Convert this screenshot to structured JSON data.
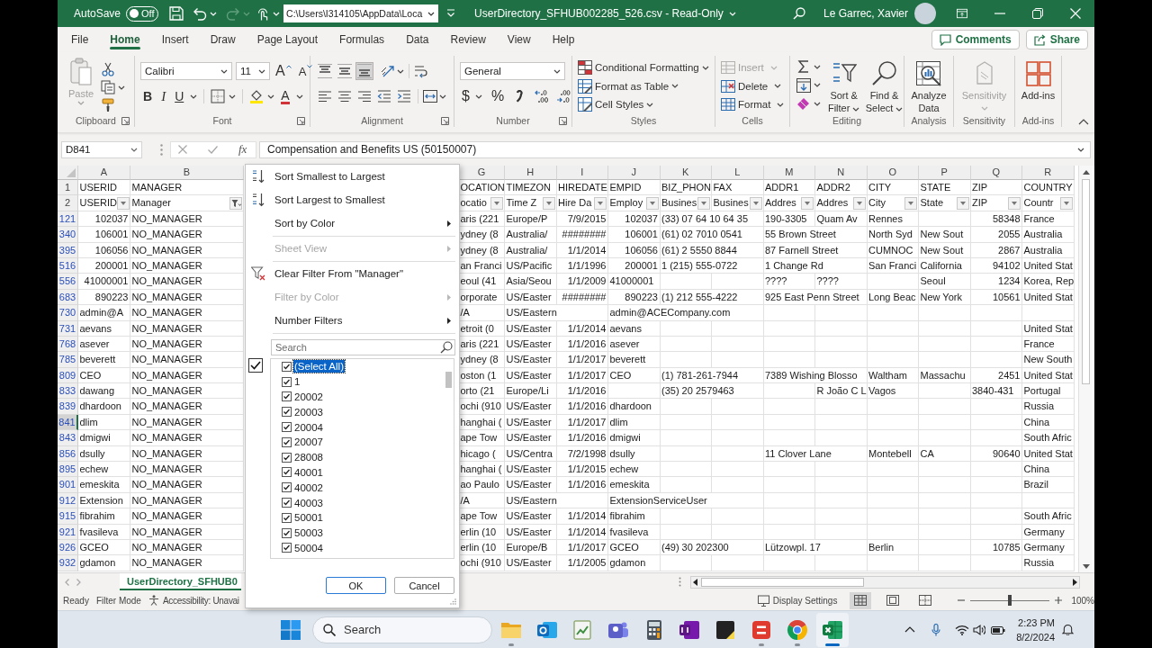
{
  "title_bar": {
    "autosave_label": "AutoSave",
    "autosave_on": false,
    "autosave_state": "Off",
    "redo_disabled": true,
    "file_path": "C:\\Users\\I314105\\AppData\\Loca",
    "document_title": "UserDirectory_SFHUB002285_526.csv - Read-Only",
    "user_name": "Le Garrec, Xavier"
  },
  "menu_tabs": [
    {
      "label": "File",
      "selected": false
    },
    {
      "label": "Home",
      "selected": true
    },
    {
      "label": "Insert",
      "selected": false
    },
    {
      "label": "Draw",
      "selected": false
    },
    {
      "label": "Page Layout",
      "selected": false
    },
    {
      "label": "Formulas",
      "selected": false
    },
    {
      "label": "Data",
      "selected": false
    },
    {
      "label": "Review",
      "selected": false
    },
    {
      "label": "View",
      "selected": false
    },
    {
      "label": "Help",
      "selected": false
    }
  ],
  "header_buttons": [
    {
      "kind": "comments",
      "label": "Comments"
    },
    {
      "kind": "share",
      "label": "Share"
    }
  ],
  "ribbon": {
    "clipboard": {
      "paste": {
        "label": "Paste",
        "disabled": true
      },
      "label": "Clipboard"
    },
    "font": {
      "font_name": "Calibri",
      "font_size": "11",
      "grow": "A",
      "shrink": "A",
      "bold": "B",
      "italic": "I",
      "underline": "U",
      "font_color": "A",
      "label": "Font"
    },
    "alignment": {
      "vertical": [
        {
          "kind": "top",
          "selected": false
        },
        {
          "kind": "middle",
          "selected": false
        },
        {
          "kind": "bottom",
          "selected": true
        }
      ],
      "label": "Alignment"
    },
    "number": {
      "format": "General",
      "currency": "$",
      "percent": "%",
      "label": "Number"
    },
    "styles": {
      "items": [
        {
          "kind": "conditional",
          "label": "Conditional Formatting"
        },
        {
          "kind": "table",
          "label": "Format as Table"
        },
        {
          "kind": "cell_styles",
          "label": "Cell Styles"
        }
      ],
      "label": "Styles"
    },
    "cells": {
      "items": [
        {
          "kind": "insert",
          "label": "Insert",
          "disabled": true
        },
        {
          "kind": "delete",
          "label": "Delete",
          "disabled": false
        },
        {
          "kind": "format",
          "label": "Format",
          "disabled": false
        }
      ],
      "label": "Cells"
    },
    "editing": {
      "sort_filter": "Sort & Filter",
      "find_select": "Find & Select",
      "label": "Editing"
    },
    "analysis": {
      "analyze": "Analyze Data",
      "label": "Analysis"
    },
    "sensitivity": {
      "button": "Sensitivity",
      "disabled": true,
      "label": "Sensitivity"
    },
    "addins": {
      "button": "Add-ins",
      "label": "Add-ins"
    }
  },
  "formula_bar": {
    "name_box": "D841",
    "fx": "fx",
    "formula": "Compensation and Benefits US (50150007)"
  },
  "sheet": {
    "columns": [
      "A",
      "B",
      "G",
      "H",
      "I",
      "J",
      "K",
      "L",
      "M",
      "N",
      "O",
      "P",
      "Q",
      "R"
    ],
    "title_row": {
      "number": "1",
      "cells": {
        "A": "USERID",
        "B": "MANAGER",
        "G": "OCATION",
        "H": "TIMEZON",
        "I": "HIREDATE",
        "J": "EMPID",
        "K": "BIZ_PHON",
        "L": "FAX",
        "M": "ADDR1",
        "N": "ADDR2",
        "O": "CITY",
        "P": "STATE",
        "Q": "ZIP",
        "R": "COUNTRY"
      }
    },
    "header_row": {
      "number": "2",
      "cells": {
        "A": {
          "text": "USERID",
          "filtered": false
        },
        "B": {
          "text": "Manager",
          "filtered": true
        },
        "G": {
          "text": "ocatio",
          "filtered": false
        },
        "H": {
          "text": "Time Z",
          "filtered": false
        },
        "I": {
          "text": "Hire Da",
          "filtered": false
        },
        "J": {
          "text": "Employ",
          "filtered": false
        },
        "K": {
          "text": "Busines",
          "filtered": false
        },
        "L": {
          "text": "Busines",
          "filtered": false
        },
        "M": {
          "text": "Addres",
          "filtered": false
        },
        "N": {
          "text": "Addres",
          "filtered": false
        },
        "O": {
          "text": "City",
          "filtered": false
        },
        "P": {
          "text": "State",
          "filtered": false
        },
        "Q": {
          "text": "ZIP",
          "filtered": false
        },
        "R": {
          "text": "Countr",
          "filtered": false
        }
      }
    },
    "rows": [
      {
        "number": "121",
        "filtered": true,
        "selected": false,
        "cells": {
          "A": {
            "kind": "number",
            "text": "102037"
          },
          "B": "NO_MANAGER",
          "G": "aris (221",
          "H": "Europe/P",
          "I": {
            "kind": "number",
            "text": "7/9/2015"
          },
          "J": {
            "kind": "number",
            "text": "102037"
          },
          "K": "(33) 07 64 10 64 35",
          "M": "190-3305",
          "N": "Quam Av",
          "O": "Rennes",
          "Q": {
            "kind": "number",
            "text": "58348"
          },
          "R": "France"
        }
      },
      {
        "number": "340",
        "filtered": true,
        "selected": false,
        "cells": {
          "A": {
            "kind": "number",
            "text": "106001"
          },
          "B": "NO_MANAGER",
          "G": "ydney (8",
          "H": "Australia/",
          "I": {
            "kind": "number",
            "text": "########"
          },
          "J": {
            "kind": "number",
            "text": "106001"
          },
          "K": "(61) 02 7010 0541",
          "M": "55 Brown Street",
          "O": "North Syd",
          "P": "New Sout",
          "Q": {
            "kind": "number",
            "text": "2055"
          },
          "R": "Australia"
        }
      },
      {
        "number": "395",
        "filtered": true,
        "selected": false,
        "cells": {
          "A": {
            "kind": "number",
            "text": "106056"
          },
          "B": "NO_MANAGER",
          "G": "ydney (8",
          "H": "Australia/",
          "I": {
            "kind": "number",
            "text": "1/1/2014"
          },
          "J": {
            "kind": "number",
            "text": "106056"
          },
          "K": "(61) 2 5550 8844",
          "M": "87 Farnell Street",
          "O": "CUMNOC",
          "P": "New Sout",
          "Q": {
            "kind": "number",
            "text": "2867"
          },
          "R": "Australia"
        }
      },
      {
        "number": "516",
        "filtered": true,
        "selected": false,
        "cells": {
          "A": {
            "kind": "number",
            "text": "200001"
          },
          "B": "NO_MANAGER",
          "G": "an Franci",
          "H": "US/Pacific",
          "I": {
            "kind": "number",
            "text": "1/1/1996"
          },
          "J": {
            "kind": "number",
            "text": "200001"
          },
          "K": "1 (215) 555-0722",
          "M": "1 Change Rd",
          "O": "San Franci",
          "P": "California",
          "Q": {
            "kind": "number",
            "text": "94102"
          },
          "R": "United Stat"
        }
      },
      {
        "number": "556",
        "filtered": true,
        "selected": false,
        "cells": {
          "A": {
            "kind": "number",
            "text": "41000001"
          },
          "B": "NO_MANAGER",
          "G": "eoul (41",
          "H": "Asia/Seou",
          "I": {
            "kind": "number",
            "text": "1/1/2009"
          },
          "J": "41000001",
          "M": "????",
          "N": "????",
          "P": "Seoul",
          "Q": {
            "kind": "number",
            "text": "1234"
          },
          "R": "Korea, Rep"
        }
      },
      {
        "number": "683",
        "filtered": true,
        "selected": false,
        "cells": {
          "A": {
            "kind": "number",
            "text": "890223"
          },
          "B": "NO_MANAGER",
          "G": "orporate",
          "H": "US/Easter",
          "I": {
            "kind": "number",
            "text": "########"
          },
          "J": {
            "kind": "number",
            "text": "890223"
          },
          "K": "(1) 212 555-4222",
          "M": "925 East Penn Street",
          "O": "Long Beac",
          "P": "New York",
          "Q": {
            "kind": "number",
            "text": "10561"
          },
          "R": "United Stat"
        }
      },
      {
        "number": "730",
        "filtered": true,
        "selected": false,
        "cells": {
          "A": "admin@A",
          "B": "NO_MANAGER",
          "G": "/A",
          "H": "US/Eastern",
          "J": "admin@ACECompany.com"
        }
      },
      {
        "number": "731",
        "filtered": true,
        "selected": false,
        "cells": {
          "A": "aevans",
          "B": "NO_MANAGER",
          "G": "etroit (0",
          "H": "US/Easter",
          "I": {
            "kind": "number",
            "text": "1/1/2014"
          },
          "J": "aevans",
          "R": "United Stat"
        }
      },
      {
        "number": "768",
        "filtered": true,
        "selected": false,
        "cells": {
          "A": "asever",
          "B": "NO_MANAGER",
          "G": "aris (221",
          "H": "US/Easter",
          "I": {
            "kind": "number",
            "text": "1/1/2016"
          },
          "J": "asever",
          "R": "France"
        }
      },
      {
        "number": "785",
        "filtered": true,
        "selected": false,
        "cells": {
          "A": "beverett",
          "B": "NO_MANAGER",
          "G": "ydney (8",
          "H": "US/Easter",
          "I": {
            "kind": "number",
            "text": "1/1/2017"
          },
          "J": "beverett",
          "R": "New South"
        }
      },
      {
        "number": "809",
        "filtered": true,
        "selected": false,
        "cells": {
          "A": "CEO",
          "B": "NO_MANAGER",
          "G": "oston (1",
          "H": "US/Easter",
          "I": {
            "kind": "number",
            "text": "1/1/2017"
          },
          "J": "CEO",
          "K": "(1) 781-261-7944",
          "M": "7389 Wishing Blosso",
          "O": "Waltham",
          "P": "Massachu",
          "Q": {
            "kind": "number",
            "text": "2451"
          },
          "R": "United Stat"
        }
      },
      {
        "number": "833",
        "filtered": true,
        "selected": false,
        "cells": {
          "A": "dawang",
          "B": "NO_MANAGER",
          "G": "orto (21",
          "H": "Europe/Li",
          "I": {
            "kind": "number",
            "text": "1/1/2016"
          },
          "K": "(35) 20 2579463",
          "N": "R João C L",
          "O": "Vagos",
          "Q": "3840-431",
          "R": "Portugal"
        }
      },
      {
        "number": "839",
        "filtered": true,
        "selected": false,
        "cells": {
          "A": "dhardoon",
          "B": "NO_MANAGER",
          "G": "ochi (910",
          "H": "US/Easter",
          "I": {
            "kind": "number",
            "text": "1/1/2016"
          },
          "J": "dhardoon",
          "R": "Russia"
        }
      },
      {
        "number": "841",
        "filtered": true,
        "selected": true,
        "cells": {
          "A": "dlim",
          "B": "NO_MANAGER",
          "G": "hanghai (",
          "H": "US/Easter",
          "I": {
            "kind": "number",
            "text": "1/1/2017"
          },
          "J": "dlim",
          "R": "China"
        }
      },
      {
        "number": "843",
        "filtered": true,
        "selected": false,
        "cells": {
          "A": "dmigwi",
          "B": "NO_MANAGER",
          "G": "ape Tow",
          "H": "US/Easter",
          "I": {
            "kind": "number",
            "text": "1/1/2016"
          },
          "J": "dmigwi",
          "R": "South Afric"
        }
      },
      {
        "number": "856",
        "filtered": true,
        "selected": false,
        "cells": {
          "A": "dsully",
          "B": "NO_MANAGER",
          "G": "hicago (",
          "H": "US/Centra",
          "I": {
            "kind": "number",
            "text": "7/2/1998"
          },
          "J": "dsully",
          "M": "11 Clover Lane",
          "O": "Montebell",
          "P": "CA",
          "Q": {
            "kind": "number",
            "text": "90640"
          },
          "R": "United Stat"
        }
      },
      {
        "number": "895",
        "filtered": true,
        "selected": false,
        "cells": {
          "A": "echew",
          "B": "NO_MANAGER",
          "G": "hanghai (",
          "H": "US/Easter",
          "I": {
            "kind": "number",
            "text": "1/1/2015"
          },
          "J": "echew",
          "R": "China"
        }
      },
      {
        "number": "901",
        "filtered": true,
        "selected": false,
        "cells": {
          "A": "emeskita",
          "B": "NO_MANAGER",
          "G": "ao Paulo",
          "H": "US/Easter",
          "I": {
            "kind": "number",
            "text": "1/1/2016"
          },
          "J": "emeskita",
          "R": "Brazil"
        }
      },
      {
        "number": "912",
        "filtered": true,
        "selected": false,
        "cells": {
          "A": "Extension",
          "B": "NO_MANAGER",
          "G": "/A",
          "H": "US/Eastern",
          "J": "ExtensionServiceUser"
        }
      },
      {
        "number": "915",
        "filtered": true,
        "selected": false,
        "cells": {
          "A": "fibrahim",
          "B": "NO_MANAGER",
          "G": "ape Tow",
          "H": "US/Easter",
          "I": {
            "kind": "number",
            "text": "1/1/2014"
          },
          "J": "fibrahim",
          "R": "South Afric"
        }
      },
      {
        "number": "921",
        "filtered": true,
        "selected": false,
        "cells": {
          "A": "fvasileva",
          "B": "NO_MANAGER",
          "G": "erlin (10",
          "H": "US/Easter",
          "I": {
            "kind": "number",
            "text": "1/1/2014"
          },
          "J": "fvasileva",
          "R": "Germany"
        }
      },
      {
        "number": "926",
        "filtered": true,
        "selected": false,
        "cells": {
          "A": "GCEO",
          "B": "NO_MANAGER",
          "G": "erlin (10",
          "H": "Europe/B",
          "I": {
            "kind": "number",
            "text": "1/1/2017"
          },
          "J": "GCEO",
          "K": "(49) 30 202300",
          "M": "Lützowpl. 17",
          "O": "Berlin",
          "Q": {
            "kind": "number",
            "text": "10785"
          },
          "R": "Germany"
        }
      },
      {
        "number": "932",
        "filtered": true,
        "selected": false,
        "cells": {
          "A": "gdamon",
          "B": "NO_MANAGER",
          "G": "ochi (910",
          "H": "US/Easter",
          "I": {
            "kind": "number",
            "text": "1/1/2005"
          },
          "J": "gdamon",
          "R": "Russia"
        }
      }
    ]
  },
  "filter_menu": {
    "sections": [
      [
        {
          "kind": "sort_ascending",
          "label": "Sort Smallest to Largest",
          "disabled": false,
          "submenu": false
        },
        {
          "kind": "sort_descending",
          "label": "Sort Largest to Smallest",
          "disabled": false,
          "submenu": false
        },
        {
          "kind": "plain",
          "label": "Sort by Color",
          "disabled": false,
          "submenu": true
        }
      ],
      [
        {
          "kind": "plain",
          "label": "Sheet View",
          "disabled": true,
          "submenu": true
        }
      ],
      [
        {
          "kind": "clear_filter",
          "label": "Clear Filter From \"Manager\"",
          "disabled": false,
          "submenu": false
        },
        {
          "kind": "plain",
          "label": "Filter by Color",
          "disabled": true,
          "submenu": true
        },
        {
          "kind": "plain",
          "label": "Number Filters",
          "disabled": false,
          "submenu": true
        }
      ]
    ],
    "search_placeholder": "Search",
    "values": [
      {
        "label": "(Select All)",
        "checked": true,
        "selected": true
      },
      {
        "label": "1",
        "checked": true,
        "selected": false
      },
      {
        "label": "20002",
        "checked": true,
        "selected": false
      },
      {
        "label": "20003",
        "checked": true,
        "selected": false
      },
      {
        "label": "20004",
        "checked": true,
        "selected": false
      },
      {
        "label": "20007",
        "checked": true,
        "selected": false
      },
      {
        "label": "28008",
        "checked": true,
        "selected": false
      },
      {
        "label": "40001",
        "checked": true,
        "selected": false
      },
      {
        "label": "40002",
        "checked": true,
        "selected": false
      },
      {
        "label": "40003",
        "checked": true,
        "selected": false
      },
      {
        "label": "50001",
        "checked": true,
        "selected": false
      },
      {
        "label": "50003",
        "checked": true,
        "selected": false
      },
      {
        "label": "50004",
        "checked": true,
        "selected": false
      }
    ],
    "buttons": [
      {
        "kind": "ok",
        "label": "OK"
      },
      {
        "kind": "cancel",
        "label": "Cancel"
      }
    ]
  },
  "sheet_tabs": [
    {
      "label": "UserDirectory_SFHUB0",
      "selected": true
    }
  ],
  "status_bar": {
    "texts": [
      "Ready",
      "Filter Mode"
    ],
    "accessibility": "Accessibility: Unavai",
    "display_settings": "Display Settings",
    "views": [
      {
        "kind": "normal",
        "selected": true
      },
      {
        "kind": "page_layout",
        "selected": false
      },
      {
        "kind": "page_break",
        "selected": false
      }
    ],
    "zoom": {
      "level": 0.5,
      "reading": "100%"
    }
  },
  "taskbar": {
    "search_placeholder": "Search",
    "apps": [
      {
        "kind": "folder",
        "running": true,
        "selected": false
      },
      {
        "kind": "mail",
        "running": false,
        "selected": false
      },
      {
        "kind": "chart",
        "running": false,
        "selected": false
      },
      {
        "kind": "team",
        "running": false,
        "selected": false
      },
      {
        "kind": "calculator",
        "running": false,
        "selected": false
      },
      {
        "kind": "notebook",
        "running": false,
        "selected": false
      },
      {
        "kind": "notes",
        "running": false,
        "selected": false
      },
      {
        "kind": "stripes",
        "running": true,
        "selected": false
      },
      {
        "kind": "browser",
        "running": true,
        "selected": false
      },
      {
        "kind": "spreadsheet",
        "running": true,
        "selected": true
      }
    ],
    "time": "2:23 PM",
    "date": "8/2/2024"
  }
}
